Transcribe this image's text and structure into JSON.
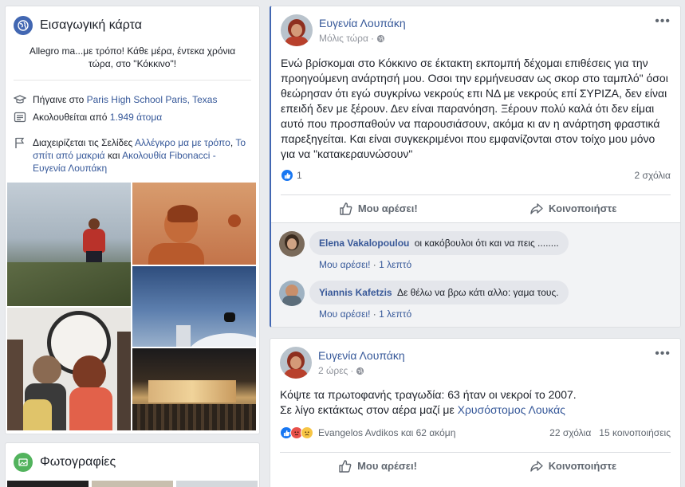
{
  "intro": {
    "title": "Εισαγωγική κάρτα",
    "bio": "Allegro ma...με τρόπο! Κάθε μέρα, έντεκα χρόνια τώρα, στο \"Κόκκινο\"!",
    "school_prefix": "Πήγαινε στο",
    "school": "Paris High School Paris, Texas",
    "followed_prefix": "Ακολουθείται από",
    "followers": "1.949 άτομα",
    "pages_prefix": "Διαχειρίζεται τις Σελίδες",
    "page1": "Αλλέγκρο μα με τρόπο",
    "page2": "Το σπίτι από μακριά",
    "and": "και",
    "page3": "Ακολουθία Fibonacci - Ευγενία Λουπάκη",
    "comma": ","
  },
  "photos": {
    "title": "Φωτογραφίες"
  },
  "post1": {
    "author": "Ευγενία Λουπάκη",
    "time": "Μόλις τώρα",
    "text": "Ενώ βρίσκομαι στο Κόκκινο σε έκτακτη εκπομπή δέχομαι επιθέσεις για την προηγούμενη ανάρτησή μου. Οσοι την ερμήνευσαν ως σκορ στο ταμπλό\" όσοι θεώρησαν ότι εγώ συγκρίνω νεκρούς επι ΝΔ με νεκρούς επί ΣΥΡΙΖΑ, δεν είναι επειδή δεν με ξέρουν. Δεν είναι παρανόηση. Ξέρουν πολύ καλά ότι δεν είμαι αυτό που προσπαθούν να παρουσιάσουν, ακόμα κι αν η ανάρτηση φραστικά παρεξηγείται. Και είναι συγκεκριμένοι που εμφανίζονται στον τοίχο μου μόνο για να \"κατακεραυνώσουν\"",
    "likes": "1",
    "comments_count": "2 σχόλια",
    "like_label": "Μου αρέσει!",
    "share_label": "Κοινοποιήστε",
    "comments": [
      {
        "name": "Elena Vakalopoulou",
        "text": "οι κακόβουλοι ότι και να πεις ........",
        "like": "Μου αρέσει!",
        "dot": "·",
        "time": "1 λεπτό"
      },
      {
        "name": "Yiannis Kafetzis",
        "text": "Δε θέλω να βρω κάτι αλλο: γαμα τους.",
        "like": "Μου αρέσει!",
        "dot": "·",
        "time": "1 λεπτό"
      }
    ]
  },
  "post2": {
    "author": "Ευγενία Λουπάκη",
    "time": "2 ώρες",
    "line1": "Κόψτε τα πρωτοφανής τραγωδία: 63 ήταν οι νεκροί το 2007.",
    "line2_prefix": "Σε λίγο εκτάκτως στον αέρα μαζί με",
    "line2_link": "Χρυσόστομος Λουκάς",
    "reactors": "Evangelos Avdikos και 62 ακόμη",
    "comments_count": "22 σχόλια",
    "shares": "15 κοινοποιήσεις",
    "like_label": "Μου αρέσει!",
    "share_label": "Κοινοποιήστε"
  },
  "colors": {
    "fb_blue": "#4267b2",
    "link": "#365899",
    "bg": "#e9ebee"
  },
  "icons": [
    "globe-icon",
    "graduation-cap-icon",
    "followers-icon",
    "flag-icon",
    "privacy-globe-icon",
    "like-reaction-icon",
    "love-reaction-icon",
    "sad-reaction-icon",
    "thumbs-up-icon",
    "share-arrow-icon",
    "more-options-icon"
  ]
}
